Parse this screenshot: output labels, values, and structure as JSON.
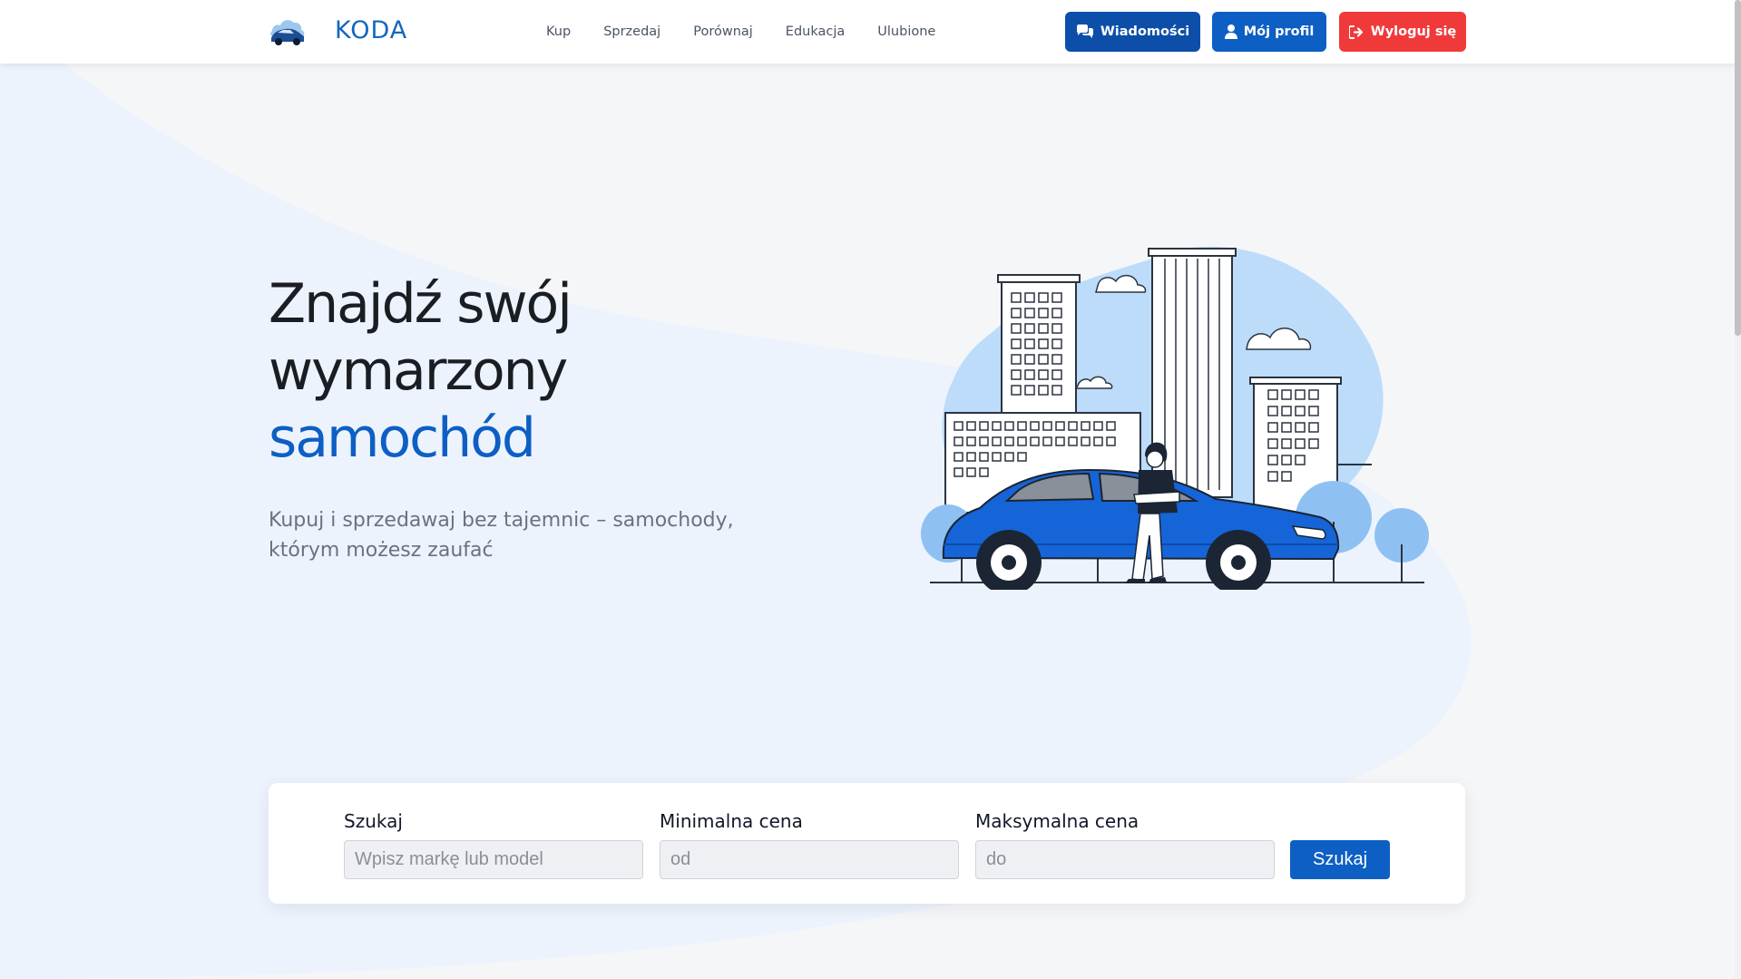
{
  "brand": {
    "name": "KODA",
    "logo_icon": "car-cloud-logo-icon"
  },
  "nav": {
    "links": [
      "Kup",
      "Sprzedaj",
      "Porównaj",
      "Edukacja",
      "Ulubione"
    ],
    "buttons": {
      "messages": "Wiadomości",
      "profile": "Mój profil",
      "logout": "Wyloguj się"
    }
  },
  "hero": {
    "title_line1": "Znajdź swój",
    "title_line2": "wymarzony",
    "title_accent": "samochód",
    "subtitle": "Kupuj i sprzedawaj bez tajemnic – samochody, którym możesz zaufać",
    "illustration_icon": "city-car-person-illustration"
  },
  "search": {
    "query_label": "Szukaj",
    "query_placeholder": "Wpisz markę lub model",
    "min_label": "Minimalna cena",
    "min_placeholder": "od",
    "max_label": "Maksymalna cena",
    "max_placeholder": "do",
    "submit_label": "Szukaj"
  },
  "colors": {
    "primary": "#0d5fc4",
    "primary_dark": "#0d4fa8",
    "danger": "#f03a3a",
    "hero_blob": "#edf3fd",
    "illustration_sky": "#bcdcfa",
    "car_body": "#1565d8"
  }
}
